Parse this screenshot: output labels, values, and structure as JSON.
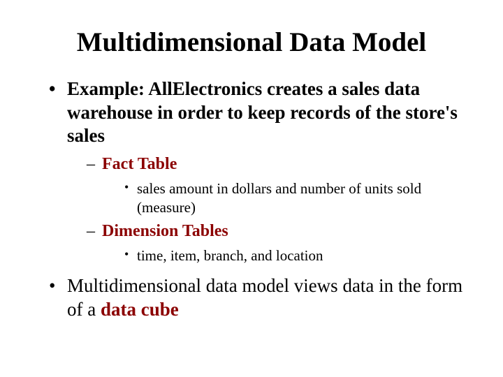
{
  "title": "Multidimensional Data Model",
  "bullets": {
    "b1_prefix": "Example: AllElectronics creates a sales data warehouse in order to keep records of the store's sales",
    "b1_sub1": "Fact Table",
    "b1_sub1_a": "sales amount in dollars and number of units sold (measure)",
    "b1_sub2": "Dimension Tables",
    "b1_sub2_a": "time, item, branch, and location",
    "b2_part1": "Multidimensional data model views data in the form of a ",
    "b2_accent": "data cube"
  }
}
